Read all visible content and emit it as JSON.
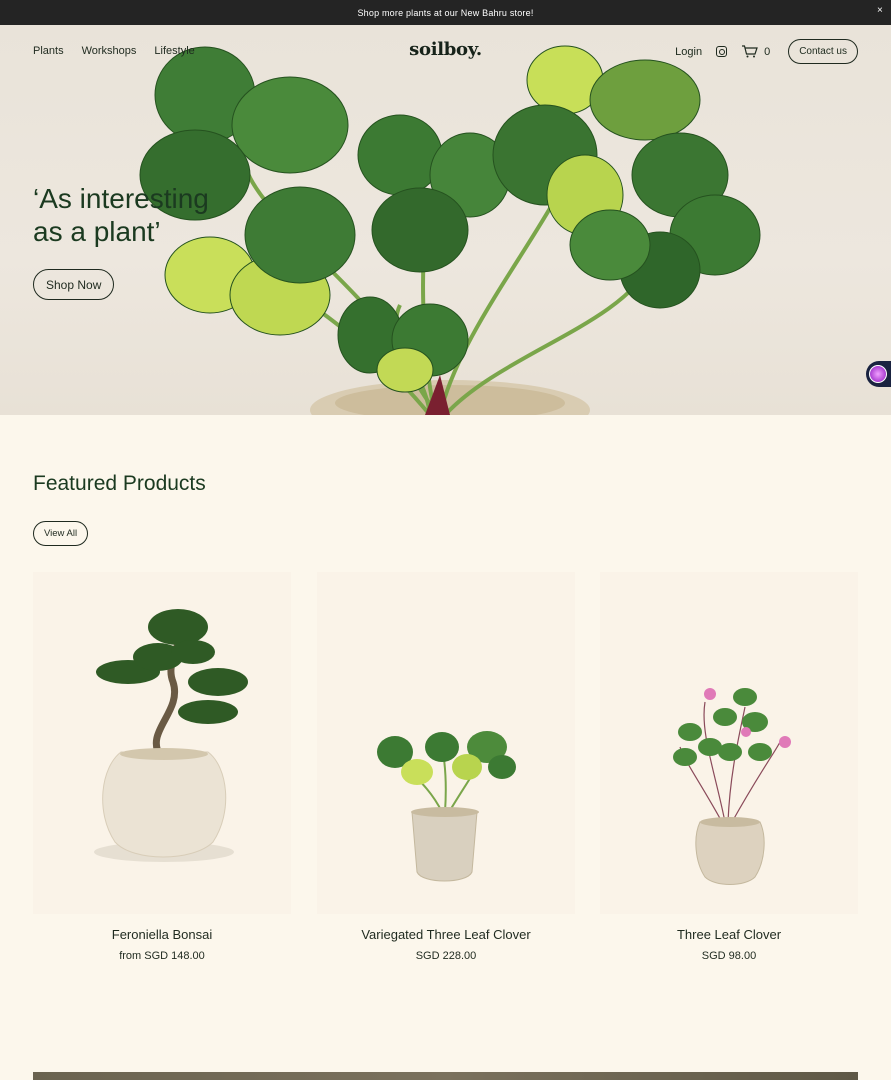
{
  "announcement": {
    "text": "Shop more plants at our New Bahru store!",
    "close": "×"
  },
  "nav": {
    "links": [
      "Plants",
      "Workshops",
      "Lifestyle"
    ],
    "logo": "soilboy.",
    "login": "Login",
    "cart_count": "0",
    "contact": "Contact us"
  },
  "hero": {
    "headline_line1": "‘As interesting",
    "headline_line2": "as a plant’",
    "cta": "Shop Now"
  },
  "featured": {
    "title": "Featured Products",
    "view_all": "View All",
    "products": [
      {
        "name": "Feroniella Bonsai",
        "price": "from SGD 148.00"
      },
      {
        "name": "Variegated Three Leaf Clover",
        "price": "SGD 228.00"
      },
      {
        "name": "Three Leaf Clover",
        "price": "SGD 98.00"
      }
    ]
  },
  "colors": {
    "announce_bg": "#242424",
    "page_bg": "#fcf7ec",
    "text": "#1d2a1d",
    "leaf": "#3c7a33",
    "leaf_light": "#c9df5a"
  },
  "icons": [
    "instagram-icon",
    "cart-icon",
    "close-icon",
    "accessibility-icon"
  ]
}
